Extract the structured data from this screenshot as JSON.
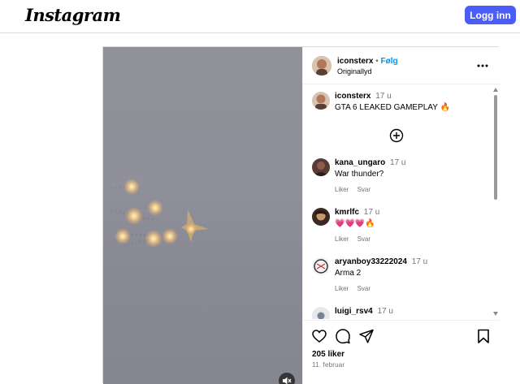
{
  "topbar": {
    "logo_text": "Instagram",
    "login_label": "Logg inn"
  },
  "post": {
    "author": "iconsterx",
    "separator": "•",
    "follow_label": "Følg",
    "audio": "Originallyd",
    "more_icon": "more-horizontal-icon",
    "caption": {
      "user": "iconsterx",
      "time": "17 u",
      "text": "GTA 6 LEAKED GAMEPLAY 🔥"
    },
    "load_more_icon": "plus-circle-icon",
    "comments": [
      {
        "user": "kana_ungaro",
        "time": "17 u",
        "text": "War thunder?",
        "like": "Liker",
        "reply": "Svar"
      },
      {
        "user": "kmrlfc",
        "time": "17 u",
        "text": "💗💗💗🔥",
        "like": "Liker",
        "reply": "Svar"
      },
      {
        "user": "aryanboy33222024",
        "time": "17 u",
        "text": "Arma 2",
        "like": "Liker",
        "reply": "Svar"
      },
      {
        "user": "luigi_rsv4",
        "time": "17 u",
        "text": "",
        "like": "",
        "reply": ""
      }
    ],
    "likes": "205 liker",
    "date": "11. februar"
  }
}
